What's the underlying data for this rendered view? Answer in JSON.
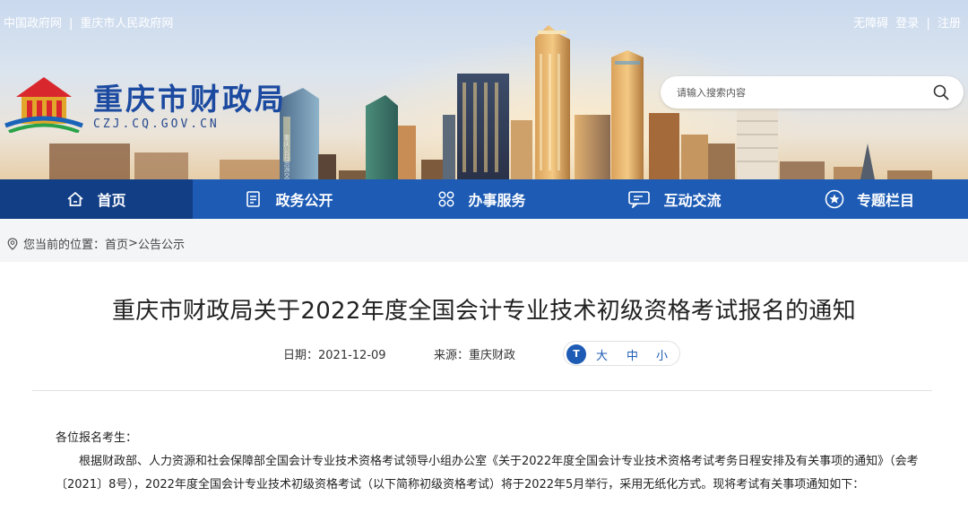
{
  "topbar": {
    "left_links": [
      "中国政府网",
      "重庆市人民政府网"
    ],
    "separator": "|",
    "right_links": [
      "无障碍",
      "登录",
      "|",
      "注册"
    ]
  },
  "site": {
    "title": "重庆市财政局",
    "domain": "CZJ.CQ.GOV.CN",
    "building_sign": "重庆公共资源交易中心"
  },
  "search": {
    "placeholder": "请输入搜索内容"
  },
  "nav": {
    "items": [
      {
        "label": "首页",
        "icon": "home-icon",
        "active": true
      },
      {
        "label": "政务公开",
        "icon": "document-icon",
        "active": false
      },
      {
        "label": "办事服务",
        "icon": "grid-icon",
        "active": false
      },
      {
        "label": "互动交流",
        "icon": "chat-icon",
        "active": false
      },
      {
        "label": "专题栏目",
        "icon": "star-badge-icon",
        "active": false
      }
    ]
  },
  "breadcrumb": {
    "prefix": "您当前的位置：",
    "home": "首页",
    "sep": ">",
    "current": "公告公示"
  },
  "article": {
    "title": "重庆市财政局关于2022年度全国会计专业技术初级资格考试报名的通知",
    "date_label": "日期：",
    "date": "2021-12-09",
    "source_label": "来源：",
    "source": "重庆财政",
    "font_icon_text": "T",
    "font_sizes": [
      "大",
      "中",
      "小"
    ],
    "salutation": "各位报名考生：",
    "paragraph": "根据财政部、人力资源和社会保障部全国会计专业技术资格考试领导小组办公室《关于2022年度全国会计专业技术资格考试考务日程安排及有关事项的通知》（会考〔2021〕8号），2022年度全国会计专业技术初级资格考试（以下简称初级资格考试）将于2022年5月举行，采用无纸化方式。现将考试有关事项通知如下："
  },
  "colors": {
    "nav_bg": "#1d5bb5",
    "nav_active": "#123e86",
    "title_blue": "#1b4aa0"
  }
}
